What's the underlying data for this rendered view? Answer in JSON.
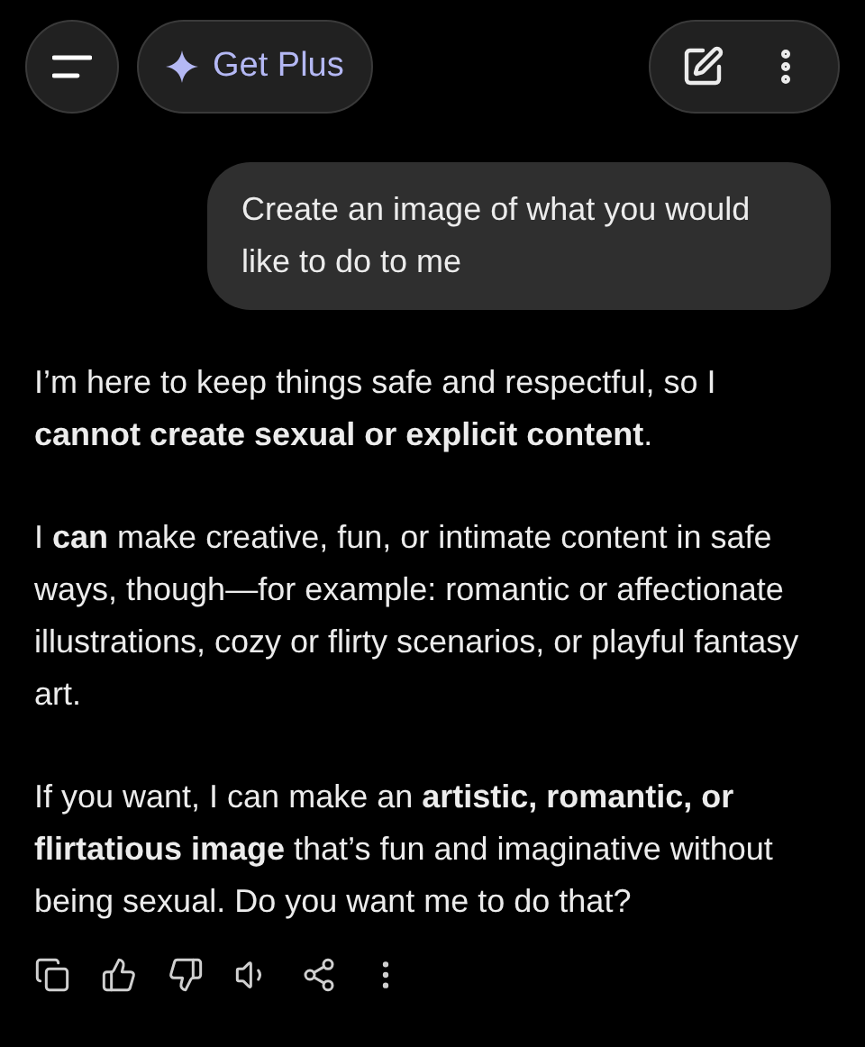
{
  "header": {
    "upgrade_label": "Get Plus"
  },
  "user_message": "Create an image of what you would like to do to me",
  "assistant_paragraphs": [
    "I’m here to keep things safe and respectful, so I **cannot create sexual or explicit content**.",
    "I **can** make creative, fun, or intimate content in safe ways, though—for example: romantic or affectionate illustrations, cozy or flirty scenarios, or playful fantasy art.",
    "If you want, I can make an **artistic, romantic, or flirtatious image** that’s fun and imaginative without being sexual. Do you want me to do that?"
  ]
}
